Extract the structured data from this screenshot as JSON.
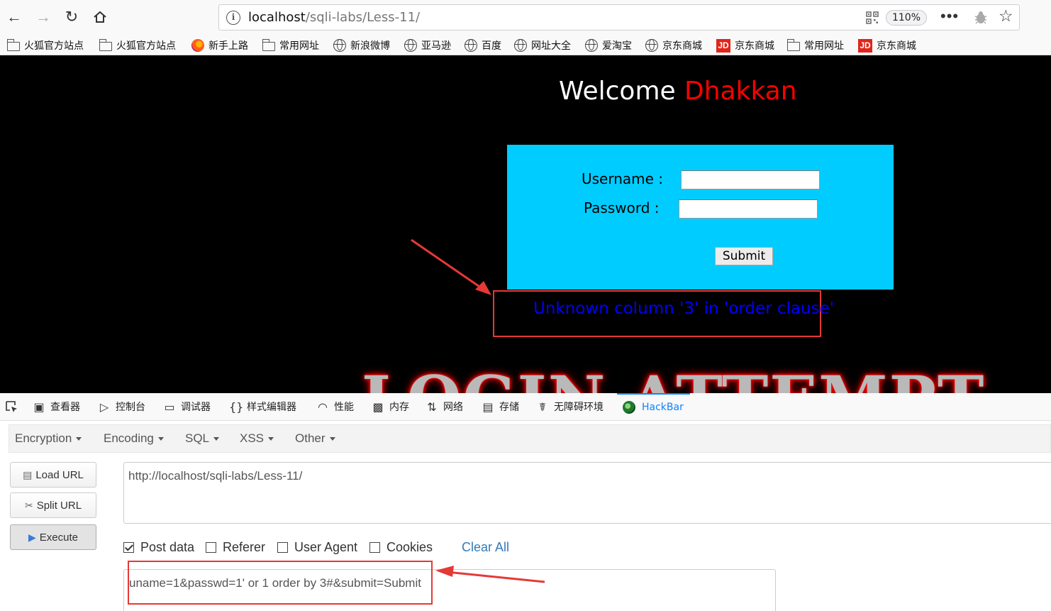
{
  "browser": {
    "url_host": "localhost",
    "url_path": "/sqli-labs/Less-11/",
    "zoom": "110%"
  },
  "bookmarks": [
    {
      "label": "火狐官方站点",
      "icon": "folder-icon"
    },
    {
      "label": "火狐官方站点",
      "icon": "folder-icon"
    },
    {
      "label": "新手上路",
      "icon": "firefox-icon"
    },
    {
      "label": "常用网址",
      "icon": "folder-icon"
    },
    {
      "label": "新浪微博",
      "icon": "globe-icon"
    },
    {
      "label": "亚马逊",
      "icon": "globe-icon"
    },
    {
      "label": "百度",
      "icon": "globe-icon"
    },
    {
      "label": "网址大全",
      "icon": "globe-icon"
    },
    {
      "label": "爱淘宝",
      "icon": "globe-icon"
    },
    {
      "label": "京东商城",
      "icon": "globe-icon"
    },
    {
      "label": "京东商城",
      "icon": "jd-icon"
    },
    {
      "label": "常用网址",
      "icon": "folder-icon"
    },
    {
      "label": "京东商城",
      "icon": "jd-icon"
    }
  ],
  "page": {
    "welcome": "Welcome",
    "user": "Dhakkan",
    "username_label": "Username :",
    "password_label": "Password :",
    "submit_label": "Submit",
    "error": "Unknown column '3' in 'order clause'",
    "banner": "LOGIN ATTEMPT"
  },
  "devtools": {
    "tabs": [
      {
        "label": "查看器",
        "icon": "inspector-icon"
      },
      {
        "label": "控制台",
        "icon": "console-icon"
      },
      {
        "label": "调试器",
        "icon": "debugger-icon"
      },
      {
        "label": "样式编辑器",
        "icon": "style-editor-icon"
      },
      {
        "label": "性能",
        "icon": "performance-icon"
      },
      {
        "label": "内存",
        "icon": "memory-icon"
      },
      {
        "label": "网络",
        "icon": "network-icon"
      },
      {
        "label": "存储",
        "icon": "storage-icon"
      },
      {
        "label": "无障碍环境",
        "icon": "accessibility-icon"
      },
      {
        "label": "HackBar",
        "icon": "hackbar-icon"
      }
    ]
  },
  "hackbar": {
    "menu": [
      "Encryption",
      "Encoding",
      "SQL",
      "XSS",
      "Other"
    ],
    "load_url": "Load URL",
    "split_url": "Split URL",
    "execute": "Execute",
    "url_value": "http://localhost/sqli-labs/Less-11/",
    "checkboxes": [
      {
        "label": "Post data",
        "checked": true
      },
      {
        "label": "Referer",
        "checked": false
      },
      {
        "label": "User Agent",
        "checked": false
      },
      {
        "label": "Cookies",
        "checked": false
      }
    ],
    "clear_all": "Clear All",
    "post_value": "uname=1&passwd=1' or 1 order by 3#&submit=Submit"
  },
  "colors": {
    "error_text": "#0000ff",
    "user_name": "#ff0000",
    "login_box": "#00ccff",
    "annotation": "#e53935",
    "accent": "#0a84ff"
  }
}
